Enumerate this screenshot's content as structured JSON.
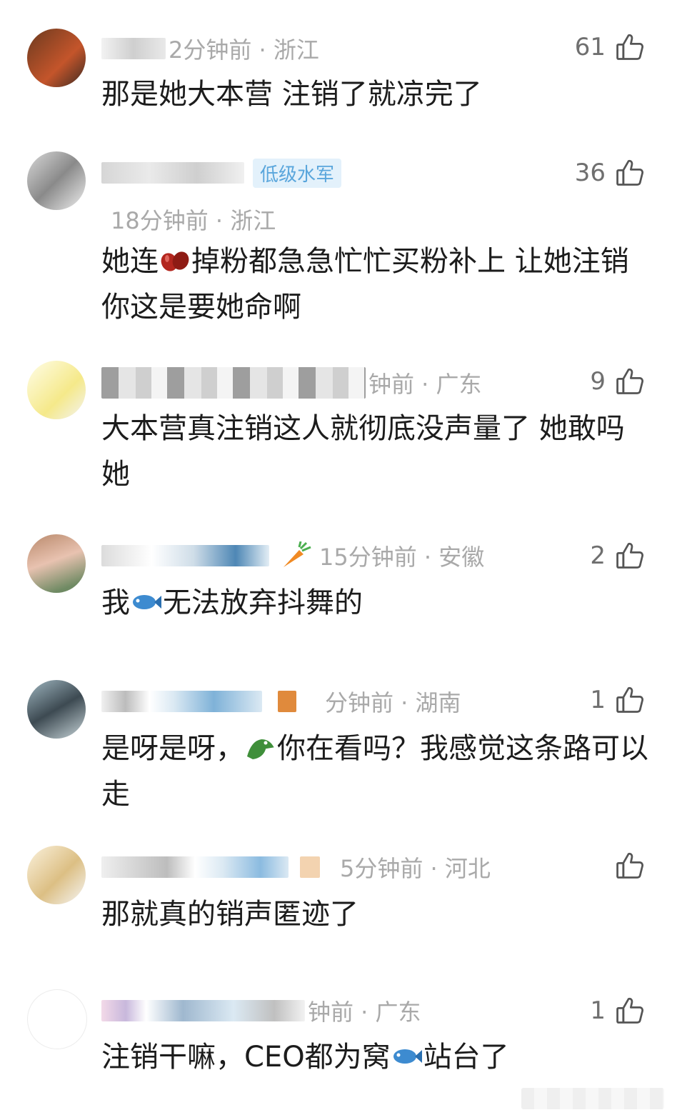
{
  "comments": [
    {
      "meta": "2分钟前 · 浙江",
      "likes": "61",
      "text": "那是她大本营 注销了就凉完了"
    },
    {
      "badge": "低级水军",
      "meta": "18分钟前 · 浙江",
      "likes": "36",
      "text_a": "她连",
      "text_b": "掉粉都急急忙忙买粉补上  让她注销  你这是要她命啊"
    },
    {
      "meta": "钟前 · 广东",
      "likes": "9",
      "text": "大本营真注销这人就彻底没声量了 她敢吗她"
    },
    {
      "meta": "15分钟前 · 安徽",
      "likes": "2",
      "text_a": "我",
      "text_b": "无法放弃抖舞的"
    },
    {
      "meta": "分钟前 · 湖南",
      "likes": "1",
      "text_a": "是呀是呀，",
      "text_b": "你在看吗？我感觉这条路可以走"
    },
    {
      "meta": "5分钟前 · 河北",
      "likes": "",
      "text": "那就真的销声匿迹了"
    },
    {
      "meta": "钟前 · 广东",
      "likes": "1",
      "text_a": "注销干嘛，CEO都为窝",
      "text_b": "站台了"
    }
  ],
  "icons": {
    "like": "thumbs-up-icon",
    "bean": "bean-emoji",
    "fish": "fish-emoji",
    "crocodile": "crocodile-emoji",
    "carrot": "carrot-emoji"
  },
  "colors": {
    "meta_gray": "#a9a9a9",
    "badge_bg": "#e3f1fb",
    "badge_text": "#5aa6dc"
  }
}
